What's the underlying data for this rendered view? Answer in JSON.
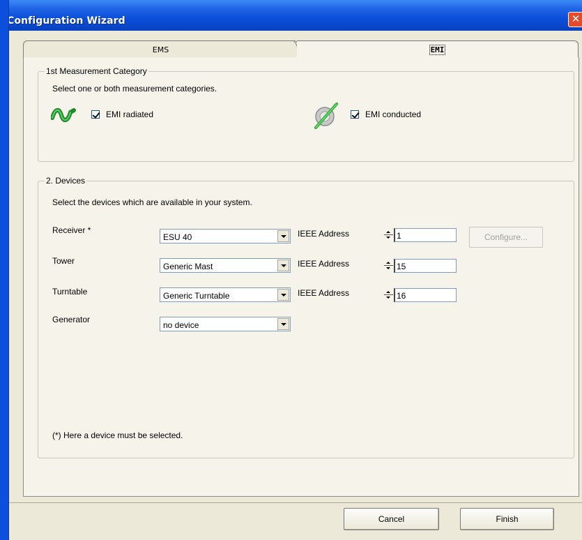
{
  "window": {
    "title": "Configuration Wizard"
  },
  "tabs": [
    {
      "label": "EMS",
      "selected": false
    },
    {
      "label": "EMI",
      "selected": true
    }
  ],
  "measurement_category": {
    "title": "1st Measurement Category",
    "instruction": "Select one or both measurement categories.",
    "emi_radiated": {
      "label": "EMI radiated",
      "checked": true,
      "icon": "radiated-wave-icon"
    },
    "emi_conducted": {
      "label": "EMI conducted",
      "checked": true,
      "icon": "conducted-cable-icon"
    }
  },
  "devices": {
    "title": "2. Devices",
    "instruction": "Select the devices which are available in your system.",
    "ieee_label": "IEEE Address",
    "configure_label": "Configure...",
    "footnote": "(*) Here a device must be selected.",
    "rows": [
      {
        "label": "Receiver *",
        "device": "ESU 40",
        "address": "1"
      },
      {
        "label": "Tower",
        "device": "Generic Mast",
        "address": "15"
      },
      {
        "label": "Turntable",
        "device": "Generic Turntable",
        "address": "16"
      },
      {
        "label": "Generator",
        "device": "no device"
      }
    ]
  },
  "buttons": {
    "cancel": "Cancel",
    "finish": "Finish"
  },
  "colors": {
    "title_bar": "#0a4fd8",
    "close_button": "#e34b2a",
    "panel_bg": "#f5f3ea",
    "window_bg": "#ece9d8"
  }
}
